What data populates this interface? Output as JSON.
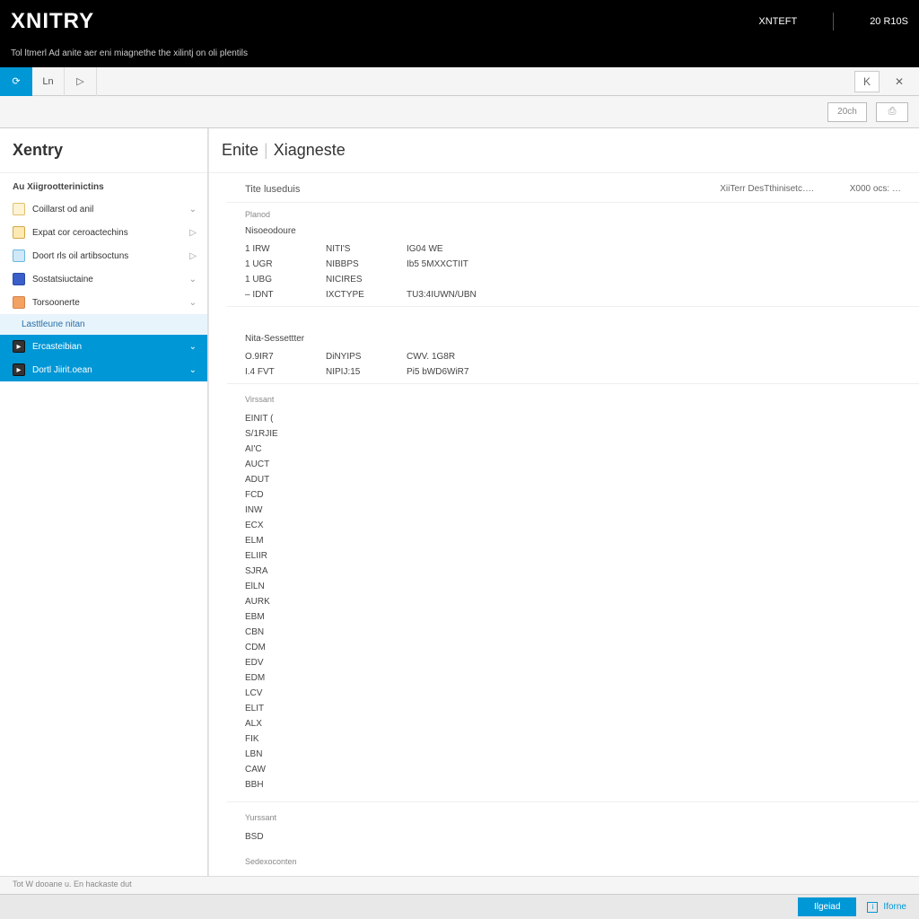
{
  "header": {
    "logo": "XNITRY",
    "right1": "XNTEFT",
    "right2": "20 R10S",
    "subtitle": "Tol ltmerl Ad anite aer eni miagnethe the xilintj on oli plentils"
  },
  "toolbar": {
    "active_icon": "⟳",
    "btn2": "Ln",
    "btn3": "▷",
    "back_icon": "K",
    "close_icon": "✕",
    "zoom": "20ch",
    "print_icon": "⎙"
  },
  "sidebar": {
    "title": "Xentry",
    "section": "Au Xiigrootterinictins",
    "items": [
      {
        "label": "Coillarst od anil",
        "chev": "⌄"
      },
      {
        "label": "Expat cor ceroactechins",
        "chev": "▷"
      },
      {
        "label": "Doort rls oil artibsoctuns",
        "chev": "▷"
      },
      {
        "label": "Sostatsiuctaine",
        "chev": "⌄"
      },
      {
        "label": "Torsoonerte",
        "chev": "⌄"
      }
    ],
    "sub_parent": "Lasttleune nitan",
    "selected": [
      {
        "label": "Ercasteibian",
        "chev": "⌄"
      },
      {
        "label": "Dortl Jiirit.oean",
        "chev": "⌄"
      }
    ]
  },
  "content": {
    "header1": "Enite",
    "header2": "Xiagneste",
    "title": "Tite luseduis",
    "meta1": "XiiTerr DesTthinisetc….",
    "meta2": "X000 ocs: …",
    "section_label": "Planod",
    "group1": "Nisoeodoure",
    "rows1": [
      {
        "c1": "1 IRW",
        "c2": "NITI'S",
        "c3": "IG04 WE"
      },
      {
        "c1": "1 UGR",
        "c2": "NIBBPS",
        "c3": "Ib5 5MXXCTIIT"
      },
      {
        "c1": "1 UBG",
        "c2": "NICIRES",
        "c3": ""
      },
      {
        "c1": "– IDNT",
        "c2": "IXCTYPE",
        "c3": "TU3:4IUWN/UBN"
      }
    ],
    "group2": "Nita-Sessettter",
    "rows2": [
      {
        "c1": "O.9IR7",
        "c2": "DiNYIPS",
        "c3": "CWV. 1G8R"
      },
      {
        "c1": "I.4 FVT",
        "c2": "NIPIJ:15",
        "c3": "Pi5 bWD6WiR7"
      }
    ],
    "vsection": "Virssant",
    "list1": [
      "EINIT (",
      "S/1RJIE",
      "AI'C",
      "AUCT",
      "ADUT",
      "FCD",
      "INW",
      "ECX",
      "ELM",
      "ELIIR",
      "SJRA",
      "ElLN",
      "AURK",
      "EBM",
      "CBN",
      "CDM",
      "EDV",
      "EDM",
      "LCV",
      "ELIT",
      "ALX",
      "FIK",
      "LBN",
      "CAW",
      "BBH"
    ],
    "vsection2": "Yurssant",
    "list2": [
      "BSD"
    ],
    "vsection3": "Sedexoconten"
  },
  "status": "Tot W dooane u. En hackaste dut",
  "footer": {
    "primary": "Ilgeiad",
    "secondary": "Iforne"
  }
}
